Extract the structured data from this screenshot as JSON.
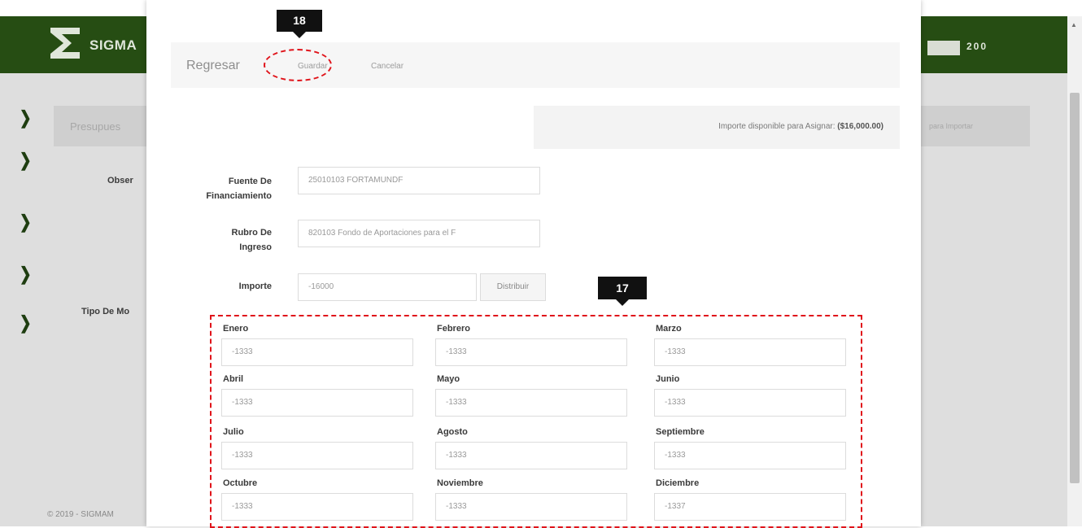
{
  "background": {
    "app_name": "SIGMA",
    "user_indicator": "200",
    "panel_title": "Presupues",
    "label_observ": "Obser",
    "label_tipo": "Tipo De Mo",
    "footer": "© 2019 - SIGMAM",
    "right_panel_text": "para Importar",
    "colors": {
      "header": "#264d13",
      "overlay": "#dedede"
    }
  },
  "modal": {
    "toolbar": {
      "regresar": "Regresar",
      "guardar": "Guardar",
      "cancelar": "Cancelar"
    },
    "available": {
      "label": "Importe disponible para Asignar:",
      "amount": "($16,000.00)"
    },
    "fields": {
      "fuente_label_1": "Fuente De",
      "fuente_label_2": "Financiamiento",
      "fuente_value": "25010103 FORTAMUNDF",
      "rubro_label_1": "Rubro De",
      "rubro_label_2": "Ingreso",
      "rubro_value": "820103 Fondo de Aportaciones para el F",
      "importe_label": "Importe",
      "importe_value": "-16000",
      "distribuir": "Distribuir"
    },
    "months": [
      {
        "label": "Enero",
        "value": "-1333"
      },
      {
        "label": "Febrero",
        "value": "-1333"
      },
      {
        "label": "Marzo",
        "value": "-1333"
      },
      {
        "label": "Abril",
        "value": "-1333"
      },
      {
        "label": "Mayo",
        "value": "-1333"
      },
      {
        "label": "Junio",
        "value": "-1333"
      },
      {
        "label": "Julio",
        "value": "-1333"
      },
      {
        "label": "Agosto",
        "value": "-1333"
      },
      {
        "label": "Septiembre",
        "value": "-1333"
      },
      {
        "label": "Octubre",
        "value": "-1333"
      },
      {
        "label": "Noviembre",
        "value": "-1333"
      },
      {
        "label": "Diciembre",
        "value": "-1337"
      }
    ]
  },
  "annotations": {
    "step_save": "18",
    "step_distribution": "17",
    "highlight_color": "#e0141b"
  }
}
